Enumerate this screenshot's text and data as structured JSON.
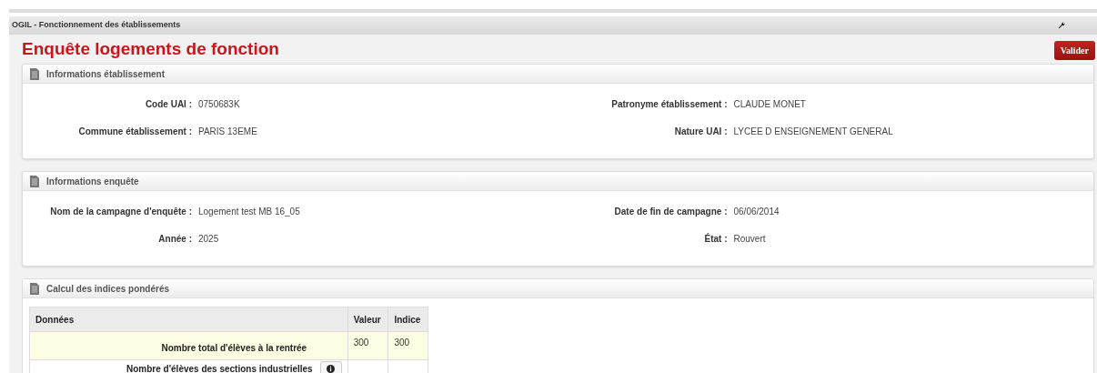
{
  "app_bar": {
    "title": "OGIL - Fonctionnement des établissements"
  },
  "page_title": "Enquête logements de fonction",
  "validate_button": "Valider",
  "panels": [
    {
      "title": "Informations établissement",
      "fields": [
        {
          "label": "Code UAI :",
          "value": "0750683K"
        },
        {
          "label": "Patronyme établissement :",
          "value": "CLAUDE MONET"
        },
        {
          "label": "Commune établissement :",
          "value": "PARIS 13EME"
        },
        {
          "label": "Nature UAI :",
          "value": "LYCEE D ENSEIGNEMENT GENERAL"
        }
      ]
    },
    {
      "title": "Informations enquête",
      "fields": [
        {
          "label": "Nom de la campagne d'enquête :",
          "value": "Logement test MB 16_05"
        },
        {
          "label": "Date de fin de campagne :",
          "value": "06/06/2014"
        },
        {
          "label": "Année :",
          "value": "2025"
        },
        {
          "label": "État :",
          "value": "Rouvert"
        }
      ]
    }
  ],
  "calc_panel": {
    "title": "Calcul des indices pondérés",
    "table": {
      "columns": [
        "Données",
        "Valeur",
        "Indice"
      ],
      "rows": [
        {
          "label": "Nombre total d'élèves à la rentrée",
          "value": "300",
          "index": "300",
          "highlighted": true,
          "info": false
        },
        {
          "label": "Nombre d'élèves des sections industrielles",
          "highlighted": false,
          "info": true
        }
      ]
    }
  }
}
